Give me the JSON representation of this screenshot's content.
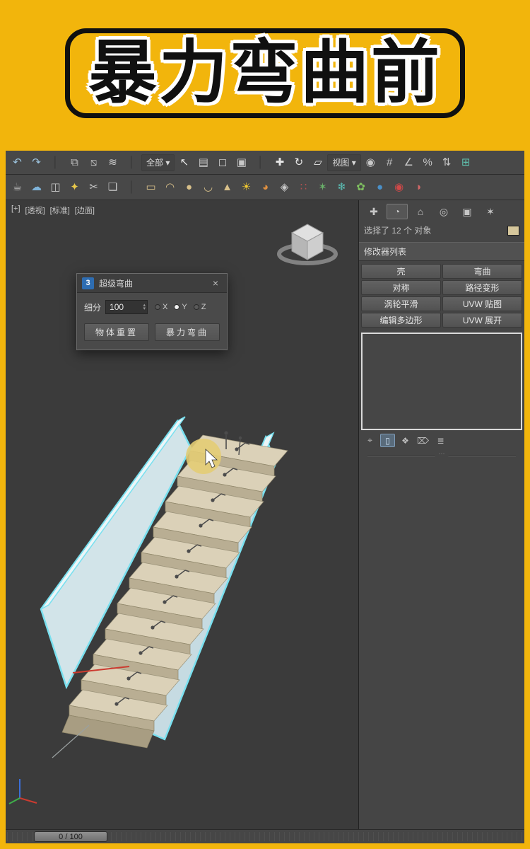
{
  "banner": {
    "title": "暴力弯曲前"
  },
  "toolbar": {
    "row1": [
      {
        "name": "undo-icon",
        "glyph": "↶",
        "color": "#9cc3de"
      },
      {
        "name": "redo-icon",
        "glyph": "↷",
        "color": "#9cc3de"
      },
      {
        "name": "toolbar-separator",
        "glyph": "│",
        "color": "#353535",
        "static": true
      },
      {
        "name": "select-and-link-icon",
        "glyph": "⧉",
        "color": "#c8c8c8"
      },
      {
        "name": "unlink-selection-icon",
        "glyph": "⧅",
        "color": "#c8c8c8"
      },
      {
        "name": "bind-to-space-warp-icon",
        "glyph": "≋",
        "color": "#c8c8c8"
      },
      {
        "name": "toolbar-separator",
        "glyph": "│",
        "color": "#353535",
        "static": true
      },
      {
        "name": "selection-filter-dropdown",
        "glyph": "全部 ▾",
        "color": "#d8d8d8"
      },
      {
        "name": "select-object-icon",
        "glyph": "↖",
        "color": "#e6e6e6"
      },
      {
        "name": "select-by-name-icon",
        "glyph": "▤",
        "color": "#c8c8c8"
      },
      {
        "name": "rectangular-selection-region-icon",
        "glyph": "◻",
        "color": "#c8c8c8"
      },
      {
        "name": "window-crossing-icon",
        "glyph": "▣",
        "color": "#c8c8c8"
      },
      {
        "name": "toolbar-separator",
        "glyph": "│",
        "color": "#353535",
        "static": true
      },
      {
        "name": "select-and-move-icon",
        "glyph": "✚",
        "color": "#e6e6e6"
      },
      {
        "name": "select-and-rotate-icon",
        "glyph": "↻",
        "color": "#e6e6e6"
      },
      {
        "name": "select-and-scale-icon",
        "glyph": "▱",
        "color": "#e6e6e6"
      },
      {
        "name": "reference-coordinate-dropdown",
        "glyph": "视图 ▾",
        "color": "#d8d8d8"
      },
      {
        "name": "use-pivot-point-icon",
        "glyph": "◉",
        "color": "#c8c8c8"
      },
      {
        "name": "snap-toggle-icon",
        "glyph": "#",
        "color": "#c8c8c8"
      },
      {
        "name": "angle-snap-icon",
        "glyph": "∠",
        "color": "#c8c8c8"
      },
      {
        "name": "percent-snap-icon",
        "glyph": "%",
        "color": "#c8c8c8"
      },
      {
        "name": "spinner-snap-icon",
        "glyph": "⇅",
        "color": "#c8c8c8"
      },
      {
        "name": "edit-named-selection-icon",
        "glyph": "⊞",
        "color": "#5fc0ae"
      }
    ],
    "row2": [
      {
        "name": "render-teapot-icon",
        "glyph": "☕",
        "color": "#c9c9c9"
      },
      {
        "name": "cloud-icon",
        "glyph": "☁",
        "color": "#7fb3d9"
      },
      {
        "name": "mirror-icon",
        "glyph": "◫",
        "color": "#c9c9c9"
      },
      {
        "name": "lamp-icon",
        "glyph": "✦",
        "color": "#e8c84a"
      },
      {
        "name": "scissors-icon",
        "glyph": "✂",
        "color": "#c9c9c9"
      },
      {
        "name": "layer-manager-icon",
        "glyph": "❏",
        "color": "#c9c9c9"
      },
      {
        "name": "toolbar-separator",
        "glyph": "│",
        "color": "#353535",
        "static": true
      },
      {
        "name": "box-primitive-icon",
        "glyph": "▭",
        "color": "#d8c08a"
      },
      {
        "name": "dome-primitive-icon",
        "glyph": "◠",
        "color": "#d8c08a"
      },
      {
        "name": "sphere-primitive-icon",
        "glyph": "●",
        "color": "#d8c08a"
      },
      {
        "name": "bowl-primitive-icon",
        "glyph": "◡",
        "color": "#d8c08a"
      },
      {
        "name": "cone-primitive-icon",
        "glyph": "▲",
        "color": "#d8c08a"
      },
      {
        "name": "sun-light-icon",
        "glyph": "☀",
        "color": "#f0c830"
      },
      {
        "name": "geosphere-icon",
        "glyph": "◕",
        "color": "#e09040"
      },
      {
        "name": "net-icon",
        "glyph": "◈",
        "color": "#c9c9c9"
      },
      {
        "name": "particles-icon",
        "glyph": "∷",
        "color": "#b05050"
      },
      {
        "name": "polyhedron-icon",
        "glyph": "✶",
        "color": "#6ab06a"
      },
      {
        "name": "snowflake-icon",
        "glyph": "❄",
        "color": "#5bbfb5"
      },
      {
        "name": "plant-icon",
        "glyph": "✿",
        "color": "#7fc060"
      },
      {
        "name": "blue-sphere-icon",
        "glyph": "●",
        "color": "#4a90c8"
      },
      {
        "name": "color-wheel-icon",
        "glyph": "◉",
        "color": "#d04848"
      },
      {
        "name": "half-sphere-icon",
        "glyph": "◑",
        "color": "#d06868"
      }
    ]
  },
  "viewport": {
    "labels": [
      {
        "name": "viewport-menu-general",
        "label": "[+]"
      },
      {
        "name": "viewport-menu-pov",
        "label": "[透视]"
      },
      {
        "name": "viewport-menu-shading",
        "label": "[标准]"
      },
      {
        "name": "viewport-menu-display",
        "label": "[边面]"
      }
    ]
  },
  "dialog": {
    "icon_label": "3",
    "title": "超级弯曲",
    "close_glyph": "×",
    "subdivision_label": "细分",
    "subdivision_value": "100",
    "spinner_up": "▴",
    "spinner_down": "▾",
    "axes": [
      {
        "name": "axis-x-radio",
        "label": "X",
        "selected": false
      },
      {
        "name": "axis-y-radio",
        "label": "Y",
        "selected": true
      },
      {
        "name": "axis-z-radio",
        "label": "Z",
        "selected": false
      }
    ],
    "reset_button": "物体重置",
    "bend_button": "暴力弯曲"
  },
  "panel": {
    "tabs": [
      {
        "name": "create-tab",
        "glyph": "✚"
      },
      {
        "name": "modify-tab",
        "glyph": "◔",
        "selected": true
      },
      {
        "name": "hierarchy-tab",
        "glyph": "⌂"
      },
      {
        "name": "motion-tab",
        "glyph": "◎"
      },
      {
        "name": "display-tab",
        "glyph": "▣"
      },
      {
        "name": "utilities-tab",
        "glyph": "✶"
      }
    ],
    "selection_text": "选择了 12 个 对象",
    "modifier_list_label": "修改器列表",
    "modifier_buttons": [
      {
        "name": "modifier-shell-button",
        "label": "壳"
      },
      {
        "name": "modifier-bend-button",
        "label": "弯曲"
      },
      {
        "name": "modifier-symmetry-button",
        "label": "对称"
      },
      {
        "name": "modifier-path-deform-button",
        "label": "路径变形"
      },
      {
        "name": "modifier-turbosmooth-button",
        "label": "涡轮平滑"
      },
      {
        "name": "modifier-uvw-map-button",
        "label": "UVW 贴图"
      },
      {
        "name": "modifier-edit-poly-button",
        "label": "编辑多边形"
      },
      {
        "name": "modifier-uvw-unwrap-button",
        "label": "UVW 展开"
      }
    ],
    "stack_icons": [
      {
        "name": "pin-stack-icon",
        "glyph": "⌖"
      },
      {
        "name": "show-end-result-icon",
        "glyph": "▯",
        "selected": true
      },
      {
        "name": "make-unique-icon",
        "glyph": "❖"
      },
      {
        "name": "remove-modifier-icon",
        "glyph": "⌦"
      },
      {
        "name": "configure-modifier-sets-icon",
        "glyph": "≣"
      }
    ]
  },
  "timeline": {
    "frame_label": "0 / 100"
  },
  "colors": {
    "selection_outline": "#79e0ef",
    "cursor_highlight": "#e3cc74",
    "banner_background": "#f2b50c"
  }
}
